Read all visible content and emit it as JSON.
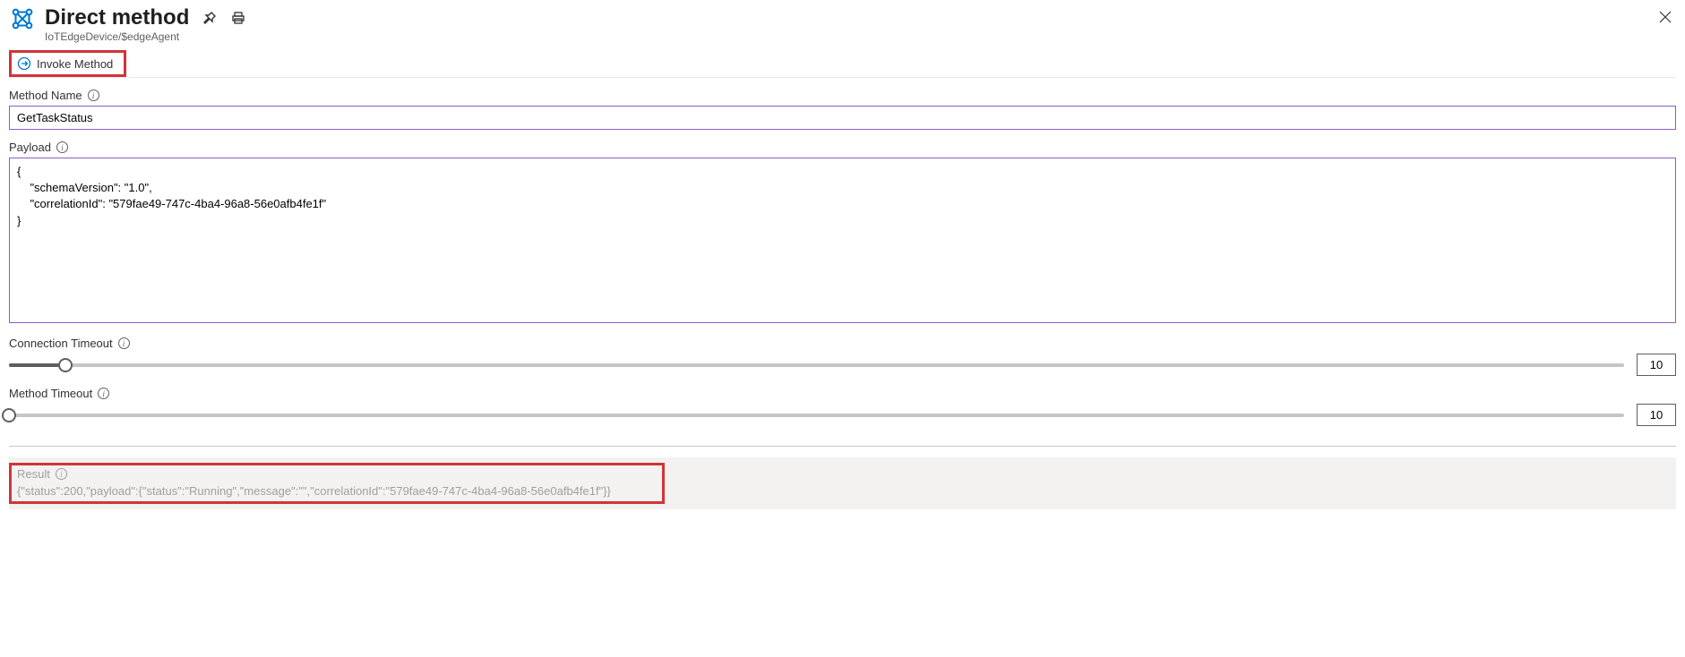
{
  "header": {
    "title": "Direct method",
    "breadcrumb": "IoTEdgeDevice/$edgeAgent"
  },
  "toolbar": {
    "invoke_label": "Invoke Method"
  },
  "method_name": {
    "label": "Method Name",
    "value": "GetTaskStatus"
  },
  "payload": {
    "label": "Payload",
    "value": "{\n    \"schemaVersion\": \"1.0\",\n    \"correlationId\": \"579fae49-747c-4ba4-96a8-56e0afb4fe1f\"\n}"
  },
  "connection_timeout": {
    "label": "Connection Timeout",
    "value": "10",
    "fill_percent": 3.5
  },
  "method_timeout": {
    "label": "Method Timeout",
    "value": "10",
    "fill_percent": 0
  },
  "result": {
    "label": "Result",
    "text": "{\"status\":200,\"payload\":{\"status\":\"Running\",\"message\":\"\",\"correlationId\":\"579fae49-747c-4ba4-96a8-56e0afb4fe1f\"}}"
  }
}
